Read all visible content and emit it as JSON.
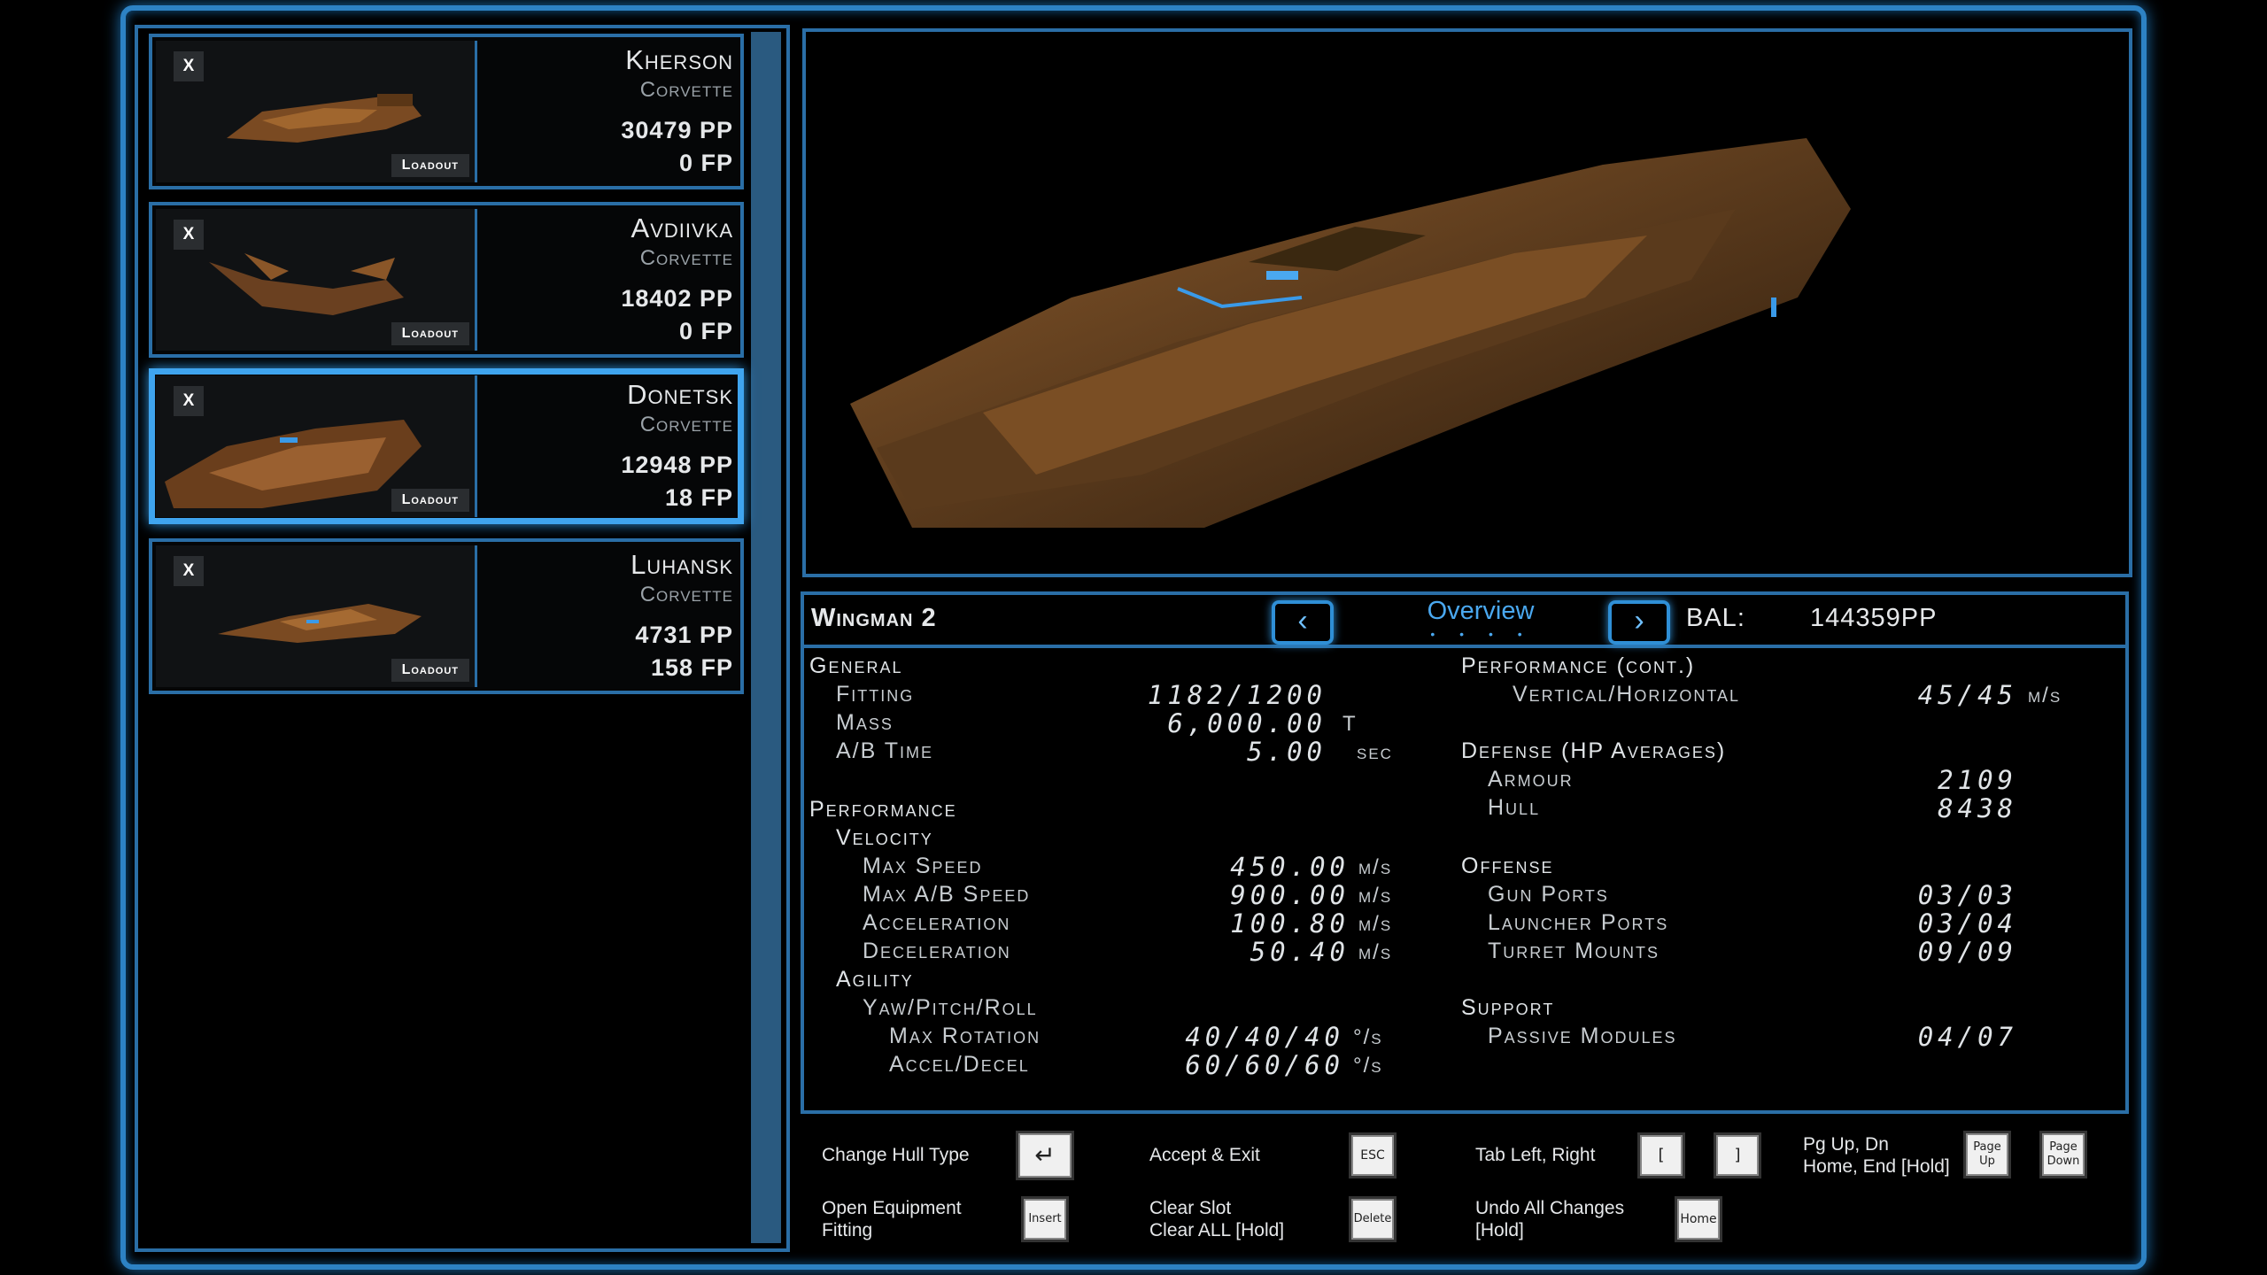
{
  "ships": [
    {
      "name": "Kherson",
      "type": "Corvette",
      "pp": "30479 PP",
      "fp": "0 FP",
      "close": "X",
      "loadout": "Loadout",
      "selected": false
    },
    {
      "name": "Avdiivka",
      "type": "Corvette",
      "pp": "18402 PP",
      "fp": "0 FP",
      "close": "X",
      "loadout": "Loadout",
      "selected": false
    },
    {
      "name": "Donetsk",
      "type": "Corvette",
      "pp": "12948 PP",
      "fp": "18 FP",
      "close": "X",
      "loadout": "Loadout",
      "selected": true
    },
    {
      "name": "Luhansk",
      "type": "Corvette",
      "pp": "4731 PP",
      "fp": "158 FP",
      "close": "X",
      "loadout": "Loadout",
      "selected": false
    }
  ],
  "header": {
    "wingman": "Wingman 2",
    "tab": "Overview",
    "dots": "• • • •",
    "bal_label": "BAL:",
    "bal_value": "144359PP"
  },
  "stats_left": {
    "general": "General",
    "fitting": "Fitting",
    "fitting_v": "1182/1200",
    "mass": "Mass",
    "mass_v": "6,000.00",
    "mass_u": "T",
    "ab_time": "A/B Time",
    "ab_time_v": "5.00",
    "ab_time_u": "sec",
    "performance": "Performance",
    "velocity": "Velocity",
    "max_speed": "Max Speed",
    "max_speed_v": "450.00",
    "max_speed_u": "m/s",
    "max_ab": "Max A/B Speed",
    "max_ab_v": "900.00",
    "max_ab_u": "m/s",
    "accel": "Acceleration",
    "accel_v": "100.80",
    "accel_u": "m/s",
    "decel": "Deceleration",
    "decel_v": "50.40",
    "decel_u": "m/s",
    "agility": "Agility",
    "ypr": "Yaw/Pitch/Roll",
    "max_rot": "Max Rotation",
    "max_rot_v": "40/40/40",
    "max_rot_u": "°/s",
    "acc_dec": "Accel/Decel",
    "acc_dec_v": "60/60/60",
    "acc_dec_u": "°/s"
  },
  "stats_right": {
    "perf_cont": "Performance (cont.)",
    "vert": "Vertical/Horizontal",
    "vert_v": "45/45",
    "vert_u": "m/s",
    "defense": "Defense (HP Averages)",
    "armour": "Armour",
    "armour_v": "2109",
    "hull": "Hull",
    "hull_v": "8438",
    "offense": "Offense",
    "gun": "Gun Ports",
    "gun_v": "03/03",
    "launcher": "Launcher Ports",
    "launcher_v": "03/04",
    "turret": "Turret Mounts",
    "turret_v": "09/09",
    "support": "Support",
    "passive": "Passive Modules",
    "passive_v": "04/07"
  },
  "hints": {
    "change_hull": "Change Hull Type",
    "accept_exit": "Accept & Exit",
    "tab_lr": "Tab Left, Right",
    "pg": "Pg Up, Dn",
    "pg2": "Home, End [Hold]",
    "open_eq": "Open Equipment",
    "open_eq2": "Fitting",
    "clear_slot": "Clear Slot",
    "clear_all": "Clear ALL [Hold]",
    "undo": "Undo All Changes",
    "undo2": "[Hold]",
    "key_enter": "↵",
    "key_esc": "ESC",
    "key_lb": "[",
    "key_rb": "]",
    "key_pgup": "Page Up",
    "key_pgdn": "Page Down",
    "key_insert": "Insert",
    "key_delete": "Delete",
    "key_home": "Home"
  }
}
